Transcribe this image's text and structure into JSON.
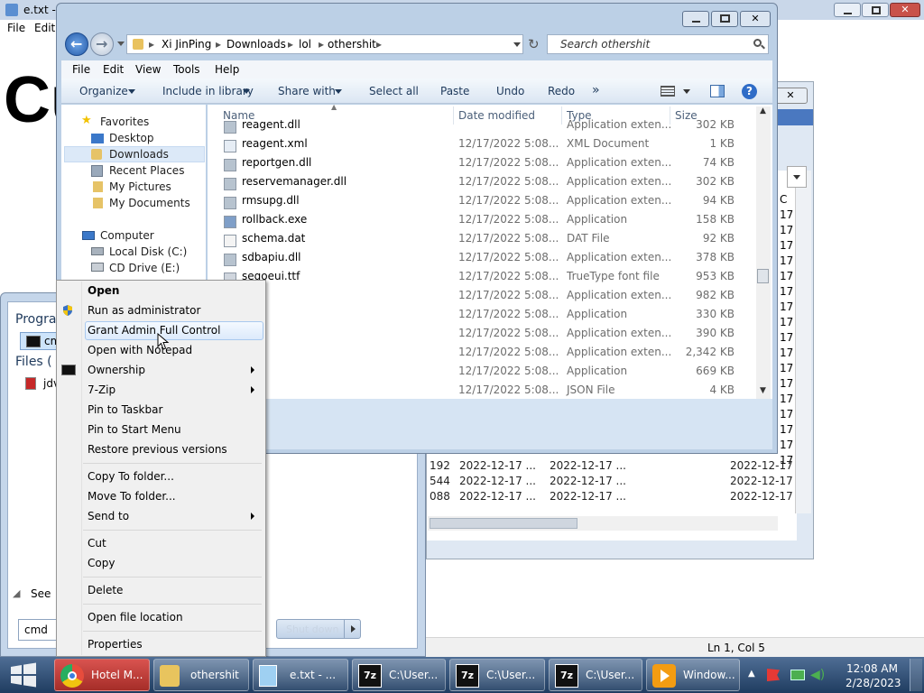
{
  "notepad": {
    "title": "e.txt -",
    "menu": [
      "File",
      "Edit"
    ],
    "big_text": "Cu",
    "status": "Ln 1, Col 5"
  },
  "sevenzip_rows": [
    {
      "size": "192",
      "c1": "2022-12-17 ...",
      "c2": "2022-12-17 ...",
      "c3": "2022-12-17"
    },
    {
      "size": "544",
      "c1": "2022-12-17 ...",
      "c2": "2022-12-17 ...",
      "c3": "2022-12-17"
    },
    {
      "size": "088",
      "c1": "2022-12-17 ...",
      "c2": "2022-12-17 ...",
      "c3": "2022-12-17"
    }
  ],
  "sevenzip_right_col": [
    "C",
    "17",
    "17",
    "17",
    "17",
    "17",
    "17",
    "17",
    "17",
    "17",
    "17",
    "17",
    "17",
    "17",
    "17",
    "17",
    "17",
    "17"
  ],
  "explorer": {
    "breadcrumb": [
      "Xi JinPing",
      "Downloads",
      "lol",
      "othershit"
    ],
    "search_placeholder": "Search othershit",
    "menu": [
      "File",
      "Edit",
      "View",
      "Tools",
      "Help"
    ],
    "toolbar": {
      "organize": "Organize",
      "include": "Include in library",
      "share": "Share with",
      "select_all": "Select all",
      "paste": "Paste",
      "undo": "Undo",
      "redo": "Redo",
      "more": "»"
    },
    "nav": {
      "favorites": "Favorites",
      "desktop": "Desktop",
      "downloads": "Downloads",
      "recent": "Recent Places",
      "pictures": "My Pictures",
      "documents": "My Documents",
      "computer": "Computer",
      "local_disk": "Local Disk (C:)",
      "cd_drive": "CD Drive (E:)"
    },
    "columns": {
      "name": "Name",
      "date": "Date modified",
      "type": "Type",
      "size": "Size"
    },
    "files": [
      {
        "name": "reagent.dll",
        "date": "",
        "type": "Application exten...",
        "size": "302 KB"
      },
      {
        "name": "reagent.xml",
        "date": "12/17/2022 5:08...",
        "type": "XML Document",
        "size": "1 KB"
      },
      {
        "name": "reportgen.dll",
        "date": "12/17/2022 5:08...",
        "type": "Application exten...",
        "size": "74 KB"
      },
      {
        "name": "reservemanager.dll",
        "date": "12/17/2022 5:08...",
        "type": "Application exten...",
        "size": "302 KB"
      },
      {
        "name": "rmsupg.dll",
        "date": "12/17/2022 5:08...",
        "type": "Application exten...",
        "size": "94 KB"
      },
      {
        "name": "rollback.exe",
        "date": "12/17/2022 5:08...",
        "type": "Application",
        "size": "158 KB"
      },
      {
        "name": "schema.dat",
        "date": "12/17/2022 5:08...",
        "type": "DAT File",
        "size": "92 KB"
      },
      {
        "name": "sdbapiu.dll",
        "date": "12/17/2022 5:08...",
        "type": "Application exten...",
        "size": "378 KB"
      },
      {
        "name": "segoeui.ttf",
        "date": "12/17/2022 5:08...",
        "type": "TrueType font file",
        "size": "953 KB"
      },
      {
        "name": "",
        "date": "12/17/2022 5:08...",
        "type": "Application exten...",
        "size": "982 KB"
      },
      {
        "name": "",
        "date": "12/17/2022 5:08...",
        "type": "Application",
        "size": "330 KB"
      },
      {
        "name": "",
        "date": "12/17/2022 5:08...",
        "type": "Application exten...",
        "size": "390 KB"
      },
      {
        "name": "",
        "date": "12/17/2022 5:08...",
        "type": "Application exten...",
        "size": "2,342 KB"
      },
      {
        "name": "",
        "date": "12/17/2022 5:08...",
        "type": "Application",
        "size": "669 KB"
      },
      {
        "name": "",
        "date": "12/17/2022 5:08...",
        "type": "JSON File",
        "size": "4 KB"
      }
    ]
  },
  "start_menu": {
    "programs_heading": "Progra",
    "program_item": "cm",
    "files_heading": "Files (",
    "file_item": "jdv",
    "see_more": "See",
    "search_value": "cmd",
    "shutdown": "Shut down"
  },
  "context_menu": {
    "open": "Open",
    "run_admin": "Run as administrator",
    "grant_admin": "Grant Admin Full Control",
    "open_notepad": "Open with Notepad",
    "ownership": "Ownership",
    "sevenzip": "7-Zip",
    "pin_taskbar": "Pin to Taskbar",
    "pin_start": "Pin to Start Menu",
    "restore": "Restore previous versions",
    "copy_to": "Copy To folder...",
    "move_to": "Move To folder...",
    "send_to": "Send to",
    "cut": "Cut",
    "copy": "Copy",
    "delete": "Delete",
    "open_location": "Open file location",
    "properties": "Properties"
  },
  "taskbar": {
    "buttons": [
      "Hotel M...",
      "othershit",
      "e.txt - ...",
      "C:\\User...",
      "C:\\User...",
      "C:\\User...",
      "Window..."
    ],
    "time": "12:08 AM",
    "date": "2/28/2023"
  },
  "colors": {
    "taskbar": "#2a4a72",
    "chrome_active": "#c0392b",
    "selection": "#cce8ff",
    "accent": "#3a72c4"
  }
}
